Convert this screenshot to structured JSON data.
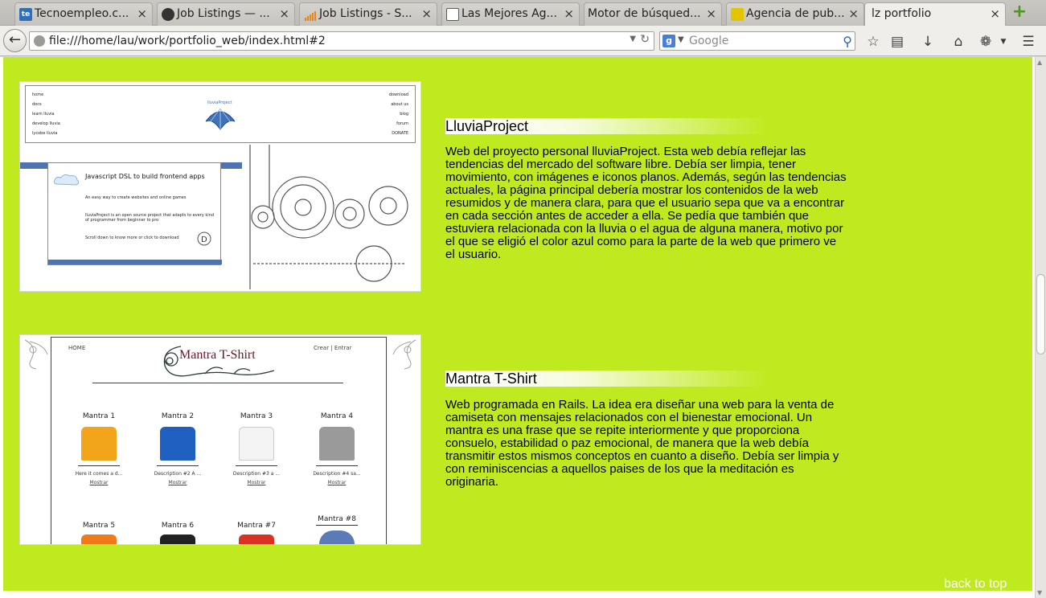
{
  "browser": {
    "tabs": [
      {
        "label": "Tecnoempleo.c...",
        "favicon_color": "#2d6fb8",
        "active": false
      },
      {
        "label": "Job Listings — ...",
        "favicon_color": "#333333",
        "active": false
      },
      {
        "label": "Job Listings - S...",
        "favicon_color": "#e8861a",
        "active": false
      },
      {
        "label": "Las Mejores Ag...",
        "favicon_color": "#5a5a5a",
        "active": false
      },
      {
        "label": "Motor de búsqued...",
        "favicon_color": "",
        "active": false
      },
      {
        "label": "Agencia de pub...",
        "favicon_color": "#e3c400",
        "active": false
      },
      {
        "label": "lz portfolio",
        "favicon_color": "",
        "active": true
      }
    ],
    "new_tab_label": "+",
    "close_glyph": "×",
    "url": "file:///home/lau/work/portfolio_web/index.html#2",
    "search_placeholder": "Google",
    "search_engine_glyph": "g"
  },
  "toolbar_icons": [
    "star-icon",
    "bookmarks-icon",
    "download-icon",
    "home-icon",
    "addon-icon",
    "menu-icon"
  ],
  "page": {
    "background": "#c0ea20",
    "projects": [
      {
        "title": "LluviaProject",
        "description": "Web del proyecto personal lluviaProject. Esta web debía reflejar las tendencias del mercado del software libre. Debía ser limpia, tener movimiento, con imágenes e iconos planos. Además, según las tendencias actuales, la página principal debería mostrar los contenidos de la web resumidos y de manera clara, para que el usuario sepa que va a encontrar en cada sección antes de acceder a ella. Se pedía que también que estuviera relacionada con la lluvia o el agua de alguna manera, motivo por el que se eligió el color azul como para la parte de la web que primero ve el usuario.",
        "shot": {
          "nav_left": [
            "home",
            "docs",
            "learn lluvia",
            "develop lluvia",
            "lycobe lluvia"
          ],
          "nav_right": [
            "download",
            "about us",
            "blog",
            "forum",
            "DONATE"
          ],
          "logo_text": "lluviaProject",
          "headline": "Javascript DSL to build frontend apps",
          "line1": "An easy way to create websites and online games",
          "line2": "lluviaProject is an open source project that adapts to every kind of programmer from beginner to pro",
          "line3": "Scroll down to know more or click to download"
        }
      },
      {
        "title": "Mantra T-Shirt",
        "description": "Web programada en Rails. La idea era diseñar una web para la venta de camiseta con mensajes relacionados con el bienestar emocional. Un mantra es una frase que se repite interiormente y que proporciona consuelo, estabilidad o paz emocional, de manera que la web debía transmitir estos mismos conceptos en cuanto a diseño. Debía ser limpia y con reminiscencias a aquellos paises de los que la meditación es originaria.",
        "shot": {
          "logo_text": "Mantra T-Shirt",
          "home": "HOME",
          "auth": "Crear | Entrar",
          "items": [
            {
              "name": "Mantra 1",
              "color": "#f2a41a",
              "desc": "Here it comes a d...",
              "link": "Mostrar"
            },
            {
              "name": "Mantra 2",
              "color": "#1f5fbf",
              "desc": "Description #2 A ...",
              "link": "Mostrar"
            },
            {
              "name": "Mantra 3",
              "color": "#f4f4f4",
              "desc": "Description #3 a ...",
              "link": "Mostrar"
            },
            {
              "name": "Mantra 4",
              "color": "#9a9a9a",
              "desc": "Description #4 sa...",
              "link": "Mostrar"
            }
          ],
          "items_row2": [
            {
              "name": "Mantra 5",
              "color": "#f07a1a"
            },
            {
              "name": "Mantra 6",
              "color": "#222222"
            },
            {
              "name": "Mantra #7",
              "color": "#d83222"
            },
            {
              "name": "Mantra #8",
              "color": "#5a7ab8"
            }
          ]
        }
      }
    ],
    "back_to_top": "back to top"
  }
}
